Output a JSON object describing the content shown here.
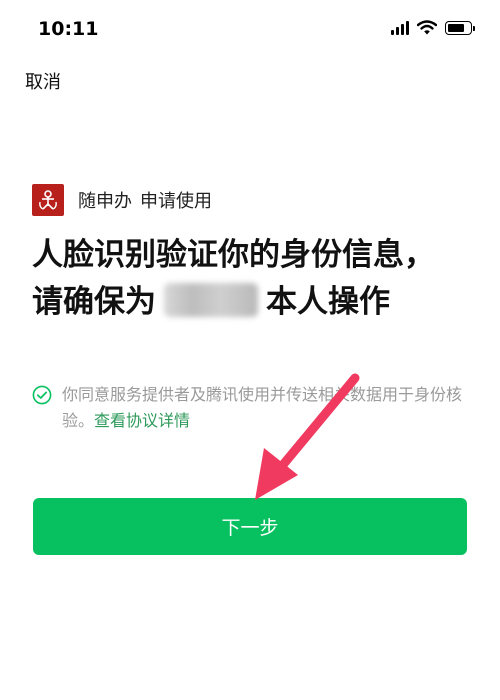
{
  "status_bar": {
    "time": "10:11",
    "icons": [
      "signal-icon",
      "wifi-icon",
      "battery-icon"
    ]
  },
  "header": {
    "cancel_label": "取消"
  },
  "app": {
    "name": "随申办",
    "action": "申请使用",
    "logo_icon": "app-logo-icon"
  },
  "headline": {
    "line1": "人脸识别验证你的身份信息，",
    "line2_prefix": "请确保为",
    "line2_suffix": "本人操作"
  },
  "agreement": {
    "checked": true,
    "text": "你同意服务提供者及腾讯使用并传送相关数据用于身份核验。",
    "link_label": "查看协议详情"
  },
  "next_button": {
    "label": "下一步"
  },
  "colors": {
    "accent_green": "#07c160",
    "link_green": "#2e9a5a",
    "logo_red": "#b8211b",
    "annotation_arrow": "#f03a5f"
  }
}
